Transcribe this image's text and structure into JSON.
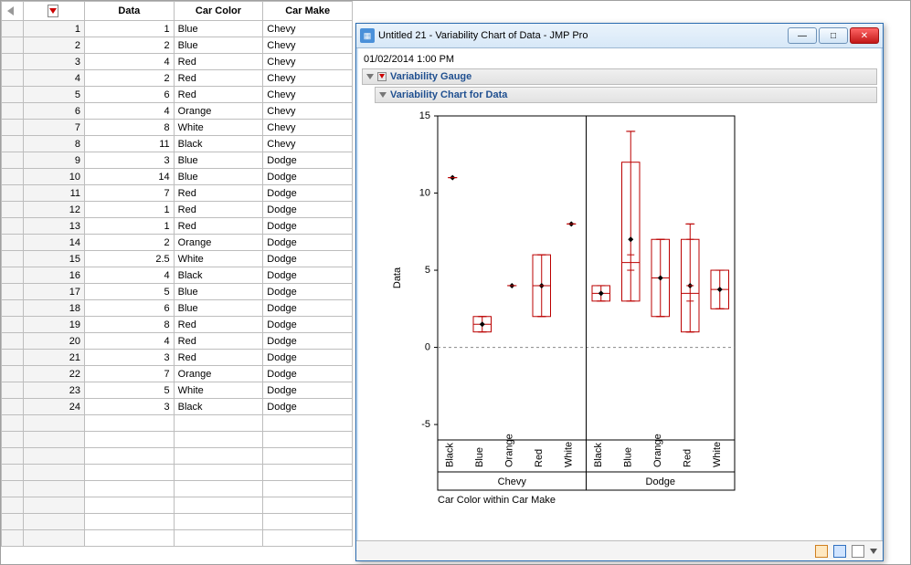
{
  "table": {
    "headers": [
      "Data",
      "Car Color",
      "Car Make"
    ],
    "rows": [
      {
        "n": 1,
        "d": "1",
        "c": "Blue",
        "m": "Chevy"
      },
      {
        "n": 2,
        "d": "2",
        "c": "Blue",
        "m": "Chevy"
      },
      {
        "n": 3,
        "d": "4",
        "c": "Red",
        "m": "Chevy"
      },
      {
        "n": 4,
        "d": "2",
        "c": "Red",
        "m": "Chevy"
      },
      {
        "n": 5,
        "d": "6",
        "c": "Red",
        "m": "Chevy"
      },
      {
        "n": 6,
        "d": "4",
        "c": "Orange",
        "m": "Chevy"
      },
      {
        "n": 7,
        "d": "8",
        "c": "White",
        "m": "Chevy"
      },
      {
        "n": 8,
        "d": "11",
        "c": "Black",
        "m": "Chevy"
      },
      {
        "n": 9,
        "d": "3",
        "c": "Blue",
        "m": "Dodge"
      },
      {
        "n": 10,
        "d": "14",
        "c": "Blue",
        "m": "Dodge"
      },
      {
        "n": 11,
        "d": "7",
        "c": "Red",
        "m": "Dodge"
      },
      {
        "n": 12,
        "d": "1",
        "c": "Red",
        "m": "Dodge"
      },
      {
        "n": 13,
        "d": "1",
        "c": "Red",
        "m": "Dodge"
      },
      {
        "n": 14,
        "d": "2",
        "c": "Orange",
        "m": "Dodge"
      },
      {
        "n": 15,
        "d": "2.5",
        "c": "White",
        "m": "Dodge"
      },
      {
        "n": 16,
        "d": "4",
        "c": "Black",
        "m": "Dodge"
      },
      {
        "n": 17,
        "d": "5",
        "c": "Blue",
        "m": "Dodge"
      },
      {
        "n": 18,
        "d": "6",
        "c": "Blue",
        "m": "Dodge"
      },
      {
        "n": 19,
        "d": "8",
        "c": "Red",
        "m": "Dodge"
      },
      {
        "n": 20,
        "d": "4",
        "c": "Red",
        "m": "Dodge"
      },
      {
        "n": 21,
        "d": "3",
        "c": "Red",
        "m": "Dodge"
      },
      {
        "n": 22,
        "d": "7",
        "c": "Orange",
        "m": "Dodge"
      },
      {
        "n": 23,
        "d": "5",
        "c": "White",
        "m": "Dodge"
      },
      {
        "n": 24,
        "d": "3",
        "c": "Black",
        "m": "Dodge"
      }
    ]
  },
  "window": {
    "title": "Untitled 21 - Variability Chart of Data - JMP Pro",
    "timestamp": "01/02/2014 1:00 PM",
    "panel1": "Variability Gauge",
    "panel2": "Variability Chart for Data"
  },
  "chart_data": {
    "type": "boxplot",
    "ylabel": "Data",
    "xlabel": "Car Color within Car Make",
    "ylim": [
      -6,
      15
    ],
    "yticks": [
      -5,
      0,
      5,
      10,
      15
    ],
    "groups": [
      "Chevy",
      "Dodge"
    ],
    "categories": [
      "Black",
      "Blue",
      "Orange",
      "Red",
      "White"
    ],
    "series": [
      {
        "group": "Chevy",
        "cat": "Black",
        "values": [
          11
        ],
        "q1": 11,
        "med": 11,
        "q3": 11,
        "lo": 11,
        "hi": 11,
        "mean": 11
      },
      {
        "group": "Chevy",
        "cat": "Blue",
        "values": [
          1,
          2
        ],
        "q1": 1,
        "med": 1.5,
        "q3": 2,
        "lo": 1,
        "hi": 2,
        "mean": 1.5
      },
      {
        "group": "Chevy",
        "cat": "Orange",
        "values": [
          4
        ],
        "q1": 4,
        "med": 4,
        "q3": 4,
        "lo": 4,
        "hi": 4,
        "mean": 4
      },
      {
        "group": "Chevy",
        "cat": "Red",
        "values": [
          4,
          2,
          6
        ],
        "q1": 2,
        "med": 4,
        "q3": 6,
        "lo": 2,
        "hi": 6,
        "mean": 4
      },
      {
        "group": "Chevy",
        "cat": "White",
        "values": [
          8
        ],
        "q1": 8,
        "med": 8,
        "q3": 8,
        "lo": 8,
        "hi": 8,
        "mean": 8
      },
      {
        "group": "Dodge",
        "cat": "Black",
        "values": [
          4,
          3
        ],
        "q1": 3,
        "med": 3.5,
        "q3": 4,
        "lo": 3,
        "hi": 4,
        "mean": 3.5
      },
      {
        "group": "Dodge",
        "cat": "Blue",
        "values": [
          3,
          14,
          5,
          6
        ],
        "q1": 3,
        "med": 5.5,
        "q3": 12,
        "lo": 3,
        "hi": 14,
        "mean": 7
      },
      {
        "group": "Dodge",
        "cat": "Orange",
        "values": [
          2,
          7
        ],
        "q1": 2,
        "med": 4.5,
        "q3": 7,
        "lo": 2,
        "hi": 7,
        "mean": 4.5
      },
      {
        "group": "Dodge",
        "cat": "Red",
        "values": [
          7,
          1,
          1,
          8,
          4,
          3
        ],
        "q1": 1,
        "med": 3.5,
        "q3": 7,
        "lo": 1,
        "hi": 8,
        "mean": 4
      },
      {
        "group": "Dodge",
        "cat": "White",
        "values": [
          2.5,
          5
        ],
        "q1": 2.5,
        "med": 3.75,
        "q3": 5,
        "lo": 2.5,
        "hi": 5,
        "mean": 3.75
      }
    ]
  }
}
